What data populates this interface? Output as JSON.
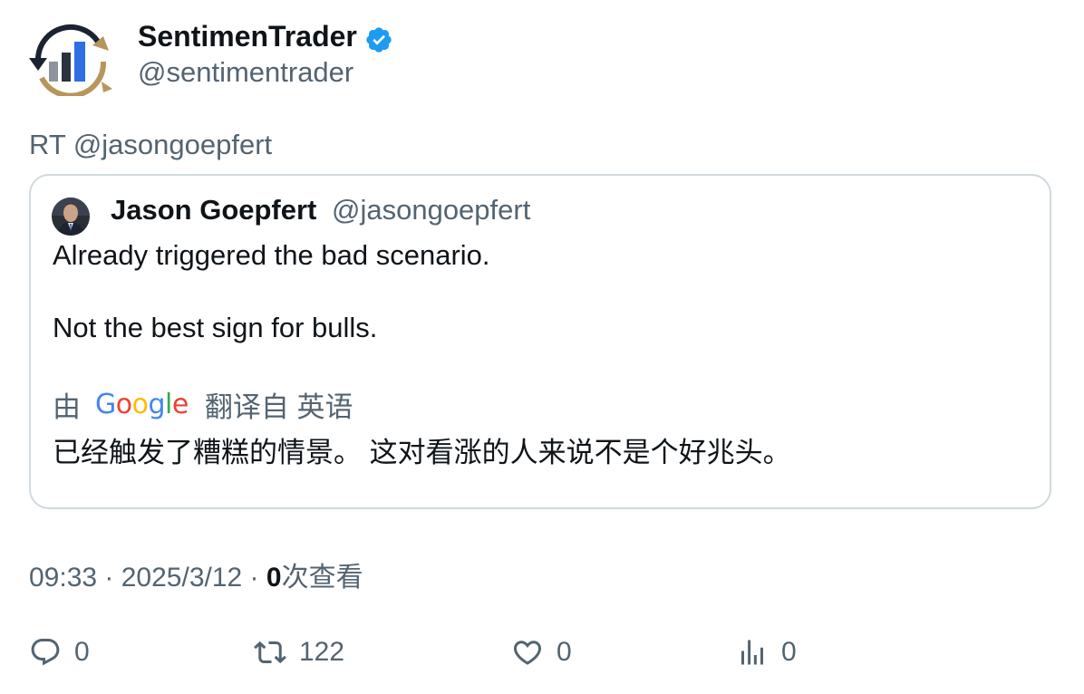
{
  "author": {
    "display_name": "SentimenTrader",
    "handle": "@sentimentrader",
    "avatar_icon": "sentimentrader-logo-icon",
    "verified_icon": "verified-badge-icon",
    "verified_color": "#1d9bf0"
  },
  "retweet_line": "RT @jasongoepfert",
  "quoted": {
    "display_name": "Jason Goepfert",
    "handle": "@jasongoepfert",
    "avatar_icon": "profile-photo-icon",
    "text_line1": "Already triggered the bad scenario.",
    "text_line2": "Not the best sign for bulls.",
    "translation": {
      "by_label": "由",
      "provider": "Google",
      "translated_from_label": "翻译自 英语",
      "text": "已经触发了糟糕的情景。 这对看涨的人来说不是个好兆头。"
    }
  },
  "meta": {
    "time": "09:33",
    "separator": " · ",
    "date": "2025/3/12",
    "views_count": "0",
    "views_label": "次查看"
  },
  "actions": {
    "reply_count": "0",
    "retweet_count": "122",
    "like_count": "0",
    "views_count": "0"
  },
  "colors": {
    "text_primary": "#0f1419",
    "text_secondary": "#536471",
    "border": "#cfd9de",
    "google_blue": "#4285F4",
    "google_red": "#EA4335",
    "google_yellow": "#FBBC05",
    "google_green": "#34A853"
  }
}
